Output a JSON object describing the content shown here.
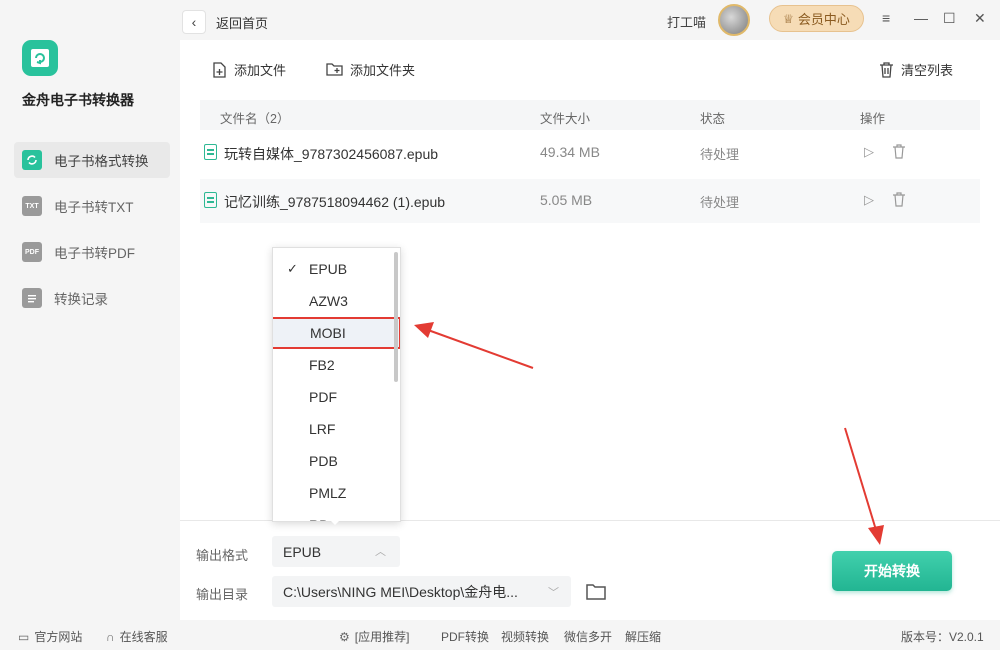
{
  "app": {
    "name": "金舟电子书转换器"
  },
  "sidebar": {
    "items": [
      {
        "label": "电子书格式转换",
        "icon": "convert-icon",
        "icon_text": "",
        "active": true
      },
      {
        "label": "电子书转TXT",
        "icon": "txt-icon",
        "icon_text": "TXT",
        "active": false
      },
      {
        "label": "电子书转PDF",
        "icon": "pdf-icon",
        "icon_text": "PDF",
        "active": false
      },
      {
        "label": "转换记录",
        "icon": "history-icon",
        "icon_text": "",
        "active": false
      }
    ]
  },
  "topbar": {
    "back_label": "返回首页",
    "user_name": "打工喵",
    "vip_label": "会员中心",
    "controls": [
      "≡",
      "—",
      "☐",
      "✕"
    ]
  },
  "toolbar": {
    "add_file": "添加文件",
    "add_folder": "添加文件夹",
    "clear_list": "清空列表"
  },
  "table": {
    "columns": [
      "文件名（2）",
      "文件大小",
      "状态",
      "操作"
    ],
    "rows": [
      {
        "name": "玩转自媒体_9787302456087.epub",
        "size": "49.34 MB",
        "status": "待处理"
      },
      {
        "name": "记忆训练_9787518094462 (1).epub",
        "size": "5.05 MB",
        "status": "待处理"
      }
    ]
  },
  "dropdown": {
    "options": [
      "EPUB",
      "AZW3",
      "MOBI",
      "FB2",
      "PDF",
      "LRF",
      "PDB",
      "PMLZ",
      "RB"
    ],
    "checked": "EPUB",
    "highlighted": "MOBI"
  },
  "settings": {
    "format_label": "输出格式",
    "format_value": "EPUB",
    "dir_label": "输出目录",
    "dir_value": "C:\\Users\\NING MEI\\Desktop\\金舟电..."
  },
  "start_button": "开始转换",
  "footer": {
    "website": "官方网站",
    "service": "在线客服",
    "recommend": "[应用推荐]",
    "links": [
      "PDF转换",
      "视频转换",
      "微信多开",
      "解压缩"
    ],
    "version": "版本号：V2.0.1"
  },
  "colors": {
    "accent": "#29c29c",
    "highlight_red": "#e33b33",
    "vip_bg": "#f6dcb6"
  }
}
